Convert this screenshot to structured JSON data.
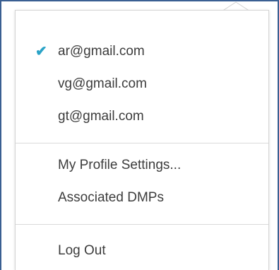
{
  "menu": {
    "accounts": [
      {
        "label": "ar@gmail.com",
        "selected": true
      },
      {
        "label": "vg@gmail.com",
        "selected": false
      },
      {
        "label": "gt@gmail.com",
        "selected": false
      }
    ],
    "check_glyph": "✔",
    "settings": [
      {
        "label": "My Profile Settings..."
      },
      {
        "label": "Associated DMPs"
      }
    ],
    "logout_label": "Log Out"
  },
  "colors": {
    "frame_border": "#3a5f92",
    "check": "#2aa3c7",
    "text": "#3c3c3c",
    "divider": "#d9d9d9"
  },
  "icons": {
    "selected": "check-icon"
  }
}
